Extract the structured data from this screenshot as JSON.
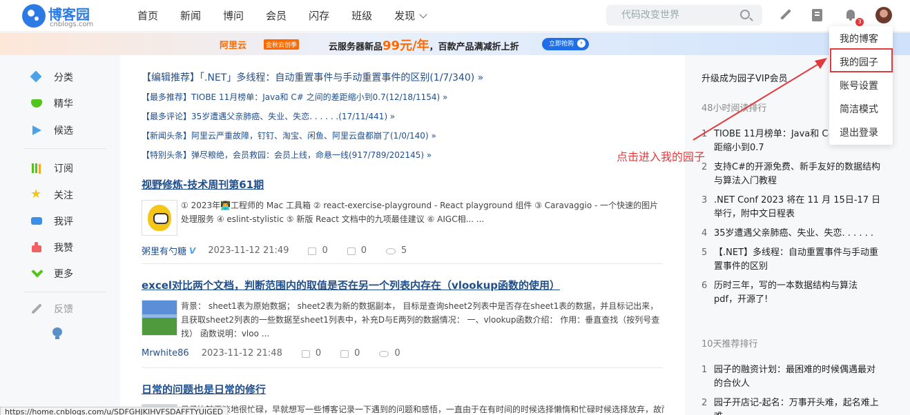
{
  "header": {
    "logo_title": "博客园",
    "logo_sub": "cnblogs.com",
    "nav": [
      "首页",
      "新闻",
      "博问",
      "会员",
      "闪存",
      "班级",
      "发现"
    ],
    "search_placeholder": "代码改变世界",
    "notification_count": "3"
  },
  "ad": {
    "brand": "阿里云",
    "tag": "金秋云创季",
    "text_pre": "云服务器新品",
    "price": "99元/年",
    "text_post": "，百款产品满减折上折",
    "button": "立即抢购"
  },
  "sidebar": {
    "items": [
      "分类",
      "精华",
      "候选",
      "订阅",
      "关注",
      "我评",
      "我赞",
      "更多",
      "反馈"
    ]
  },
  "headlines": [
    "【编辑推荐】「.NET」多线程：自动重置事件与手动重置事件的区别(1/7/340) »",
    "【最多推荐】TIOBE 11月榜单：Java和 C# 之间的差距缩小到0.7(12/18/1154) »",
    "【最多评论】35岁遭遇父亲肺癌、失业、失恋. . . . . .(17/11/441) »",
    "【新闻头条】阿里云严重故障，钉钉、淘宝、闲鱼、阿里云盘都崩了(1/0/140) »",
    "【特别头条】弹尽粮绝，会员救园：会员上线，命悬一线(917/789/202145) »"
  ],
  "posts": [
    {
      "title": "视野修炼-技术周刊第61期",
      "summary": "① 2023年👨‍💻工程师的 Mac 工具箱 ② react-exercise-playground - React playground 组件 ③ Caravaggio - 一个快速的图片处理服务 ④ eslint-stylistic ⑤ 新版 React 文档中的九项最佳建议 ⑥ AIGC相... ...",
      "author": "粥里有勺糖",
      "vip": "V",
      "date": "2023-11-12 21:49",
      "likes": "0",
      "comments": "0",
      "views": "5"
    },
    {
      "title": "excel对比两个文档，判断范围内的取值是否在另一个列表内存在（vlookup函数的使用）",
      "summary": "背景： sheet1表为原始数据； sheet2表为新的数据副本， 目标是查询sheet2列表中是否存在sheet1表的数据，并且标记出来，且获取sheet2列表的一些数据至sheet1列表中，补充D与E两列的数据情况： 一、vlookup函数介绍： 作用：垂直查找（按列号查找） 函数说明：vloo ...",
      "author": "Mrwhite86",
      "date": "2023-11-12 21:48",
      "likes": "0",
      "comments": "0",
      "views": "0"
    },
    {
      "title": "日常的问题也是日常的修行",
      "summary": "日子比较平淡地很忙碌，早就想写一些博客记录一下遇到的问题和感悟，一直由于在有时间的时候选择懒惰和忙碌时候选择放弃，故而"
    }
  ],
  "right": {
    "vip_link": "升级成为园子VIP会员",
    "rank48_title": "48小时阅读排行",
    "rank48": [
      "TIOBE 11月榜单：Java和 C# 之间的差距缩小到0.7",
      "支持C#的开源免费、新手友好的数据结构与算法入门教程",
      ".NET Conf 2023 将在 11 月 15日-17 日举行，附中文日程表",
      "35岁遭遇父亲肺癌、失业、失恋. . . . . .",
      "【.NET】多线程：自动重置事件与手动重置事件的区别",
      "历时三年，写的一本数据结构与算法pdf，开源了!"
    ],
    "rank10_title": "10天推荐排行",
    "rank10": [
      "园子的融资计划：最困难的时候偶遇最对的合伙人",
      "园子开店记-起名：万事开头难，起名难上难"
    ]
  },
  "dropdown": [
    "我的博客",
    "我的园子",
    "账号设置",
    "简洁模式",
    "退出登录"
  ],
  "annotation": "点击进入我的园子",
  "status_url": "https://home.cnblogs.com/u/SDFGHJKIHVFSDAFFTYUIGED",
  "colors": {
    "accent": "#1f4e8c",
    "annotation": "#e4393c",
    "brand": "#2c7be5"
  }
}
